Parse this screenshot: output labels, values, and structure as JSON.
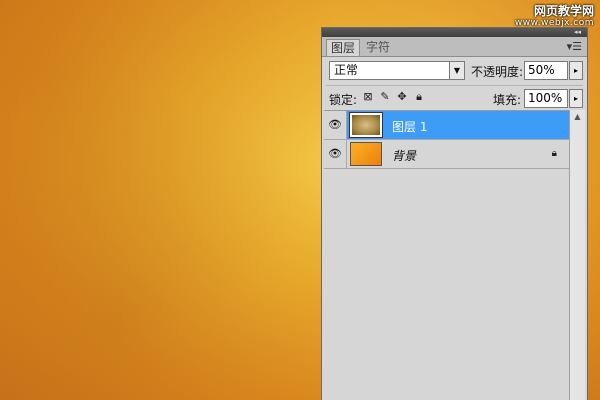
{
  "watermark": {
    "site_cn": "网页教学网",
    "site_en": "www.webjx.com"
  },
  "panel": {
    "tabs": [
      {
        "label": "图层"
      },
      {
        "label": "字符"
      }
    ],
    "menu_icon": "panel-menu-icon",
    "blend_mode": {
      "value": "正常"
    },
    "opacity": {
      "label": "不透明度:",
      "value": "50%"
    },
    "lock": {
      "label": "锁定:",
      "icons": [
        "lock-transparent-icon",
        "lock-paint-icon",
        "lock-move-icon",
        "lock-all-icon"
      ]
    },
    "fill": {
      "label": "填充:",
      "value": "100%"
    },
    "layers": [
      {
        "name": "图层 1",
        "selected": true,
        "visible": true
      },
      {
        "name": "背景",
        "selected": false,
        "visible": true,
        "locked": true
      }
    ]
  },
  "colors": {
    "selection": "#3d9cf6",
    "panel_bg": "#d6d6d6",
    "canvas_center": "#f2c544",
    "canvas_edge": "#c8741a"
  }
}
